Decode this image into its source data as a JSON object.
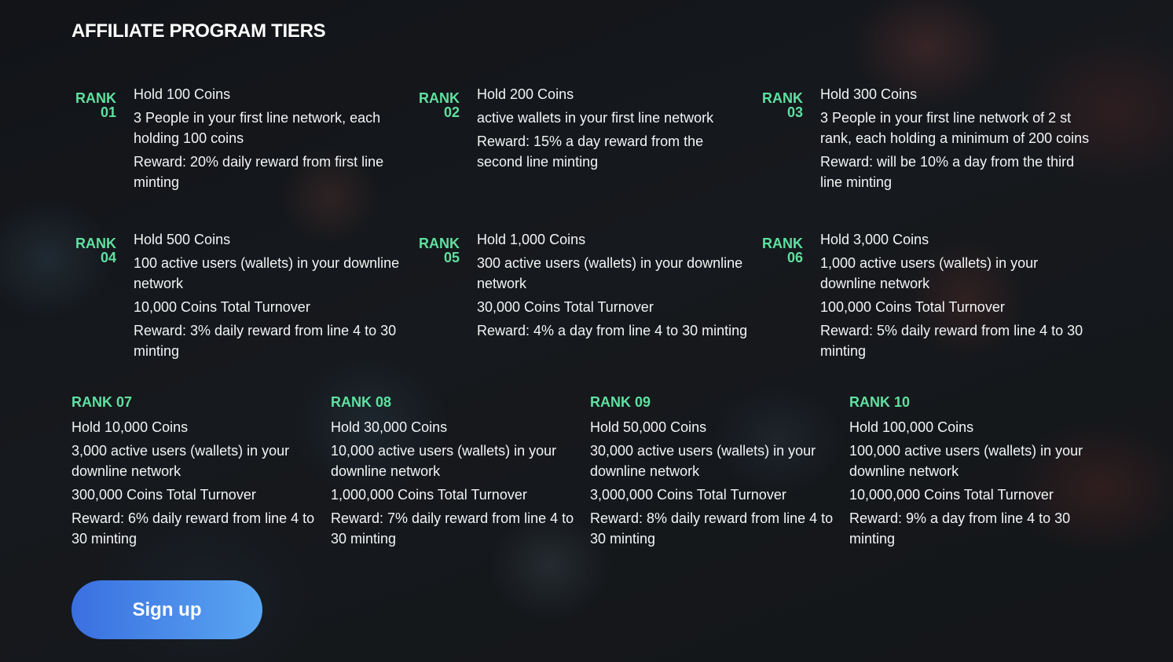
{
  "page": {
    "title": "AFFILIATE PROGRAM TIERS",
    "signup_label": "Sign up"
  },
  "colors": {
    "accent": "#5fe0a0",
    "button_start": "#3a6fe0",
    "button_end": "#5aa6f2",
    "background": "#141619"
  },
  "tiers_top": [
    {
      "rank_word": "RANK",
      "rank_num": "01",
      "lines": [
        "Hold 100 Coins",
        "3 People in your first line network, each holding 100 coins",
        "Reward: 20% daily reward from first line minting"
      ]
    },
    {
      "rank_word": "RANK",
      "rank_num": "02",
      "lines": [
        "Hold 200 Coins",
        "active wallets in your first line network",
        "Reward: 15% a day reward from the second line minting"
      ]
    },
    {
      "rank_word": "RANK",
      "rank_num": "03",
      "lines": [
        "Hold 300 Coins",
        "3 People in your first line network of 2 st rank, each holding a minimum of 200 coins",
        "Reward: will be 10% a day from the third line minting"
      ]
    },
    {
      "rank_word": "RANK",
      "rank_num": "04",
      "lines": [
        "Hold 500 Coins",
        "100 active users (wallets) in your downline network",
        "10,000 Coins Total Turnover",
        "Reward: 3% daily reward from line 4 to 30 minting"
      ]
    },
    {
      "rank_word": "RANK",
      "rank_num": "05",
      "lines": [
        "Hold 1,000 Coins",
        "300 active users (wallets) in your downline network",
        "30,000 Coins Total Turnover",
        "Reward: 4% a day from line 4 to 30 minting"
      ]
    },
    {
      "rank_word": "RANK",
      "rank_num": "06",
      "lines": [
        "Hold 3,000 Coins",
        "1,000 active users (wallets) in your downline network",
        "100,000 Coins Total Turnover",
        "Reward: 5% daily reward from line 4 to 30 minting"
      ]
    }
  ],
  "tiers_bottom": [
    {
      "rank": "RANK 07",
      "lines": [
        "Hold 10,000 Coins",
        "3,000 active users (wallets) in your downline network",
        "300,000 Coins Total Turnover",
        "Reward: 6% daily reward from line 4 to 30 minting"
      ]
    },
    {
      "rank": "RANK 08",
      "lines": [
        "Hold 30,000 Coins",
        "10,000 active users (wallets) in your downline network",
        "1,000,000 Coins Total Turnover",
        "Reward: 7% daily reward from line 4 to 30 minting"
      ]
    },
    {
      "rank": "RANK 09",
      "lines": [
        "Hold 50,000 Coins",
        "30,000 active users (wallets) in your downline network",
        "3,000,000 Coins Total Turnover",
        "Reward: 8% daily reward from line 4 to 30 minting"
      ]
    },
    {
      "rank": "RANK 10",
      "lines": [
        "Hold 100,000 Coins",
        "100,000 active users (wallets) in your downline network",
        "10,000,000 Coins Total Turnover",
        "Reward: 9% a day from line 4 to 30 minting"
      ]
    }
  ]
}
